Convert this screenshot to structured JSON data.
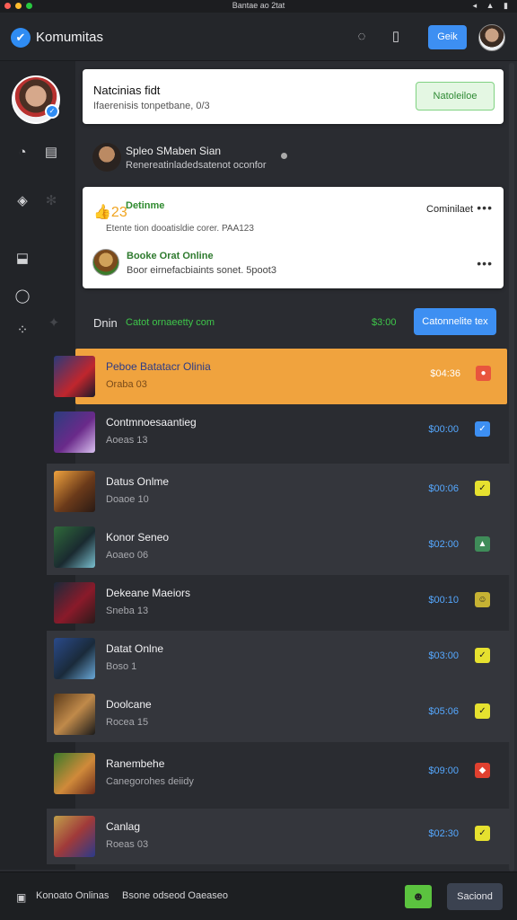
{
  "titlebar": {
    "title": "Bantae ao 2tat",
    "status_icons": "◂ ▲ ▮"
  },
  "header": {
    "brand": "Komumitas",
    "get_label": "Geik"
  },
  "notice": {
    "title": "Natcinias fidt",
    "subtitle": "Ifaerenisis tonpetbane, 0/3",
    "button": "Natoleiloe"
  },
  "activity": {
    "title": "Spleo SMaben Sian",
    "subtitle": "Renereatinladedsatenot oconfor"
  },
  "feed": {
    "item1": {
      "emoji": "👍23",
      "title": "Detinme",
      "subtitle": "Etente tion dooatisldie corer. PAA123",
      "right_label": "Cominilaet",
      "more": "•••"
    },
    "item2": {
      "title": "Booke Orat Online",
      "subtitle": "Boor eirnefacbiaints sonet. 5poot3",
      "more": "•••"
    }
  },
  "filter": {
    "label": "Dnin",
    "link": "Catot ornaeetty com",
    "price": "$3:00",
    "button": "Catonnelite tex"
  },
  "games": [
    {
      "title": "Peboe Batatacr Olinia",
      "subtitle": "Oraba 03",
      "price": "$04:36",
      "tag": "●",
      "tag_color": "#e8553d",
      "highlight": true
    },
    {
      "title": "Contmnoesaantieg",
      "subtitle": "Aoeas 13",
      "price": "$00:00",
      "tag": "✓",
      "tag_color": "#3d8ff2"
    },
    {
      "title": "Datus Onlme",
      "subtitle": "Doaoe 10",
      "price": "$00:06",
      "tag": "✓",
      "tag_color": "#e6e12f"
    },
    {
      "title": "Konor Seneo",
      "subtitle": "Aoaeo 06",
      "price": "$02:00",
      "tag": "▲",
      "tag_color": "#3f8c59"
    },
    {
      "title": "Dekeane Maeiors",
      "subtitle": "Sneba 13",
      "price": "$00:10",
      "tag": "☺",
      "tag_color": "#c6b233"
    },
    {
      "title": "Datat Onlne",
      "subtitle": "Boso 1",
      "price": "$03:00",
      "tag": "✓",
      "tag_color": "#e6e12f"
    },
    {
      "title": "Doolcane",
      "subtitle": "Rocea 15",
      "price": "$05:06",
      "tag": "✓",
      "tag_color": "#e6e12f"
    },
    {
      "title": "Ranembehe",
      "subtitle": "Canegorohes deiidy",
      "price": "$09:00",
      "tag": "◆",
      "tag_color": "#e0402f"
    },
    {
      "title": "Canlag",
      "subtitle": "Roeas 03",
      "price": "$02:30",
      "tag": "✓",
      "tag_color": "#e6e12f"
    }
  ],
  "footer": {
    "text1": "Konoato Onlinas",
    "text2": "Bsone odseod Oaeaseo",
    "emoji": "☻",
    "button": "Saciond"
  },
  "colors": {
    "accent": "#3d8ff2",
    "highlight": "#f0a33e",
    "positive": "#3ec64a"
  }
}
